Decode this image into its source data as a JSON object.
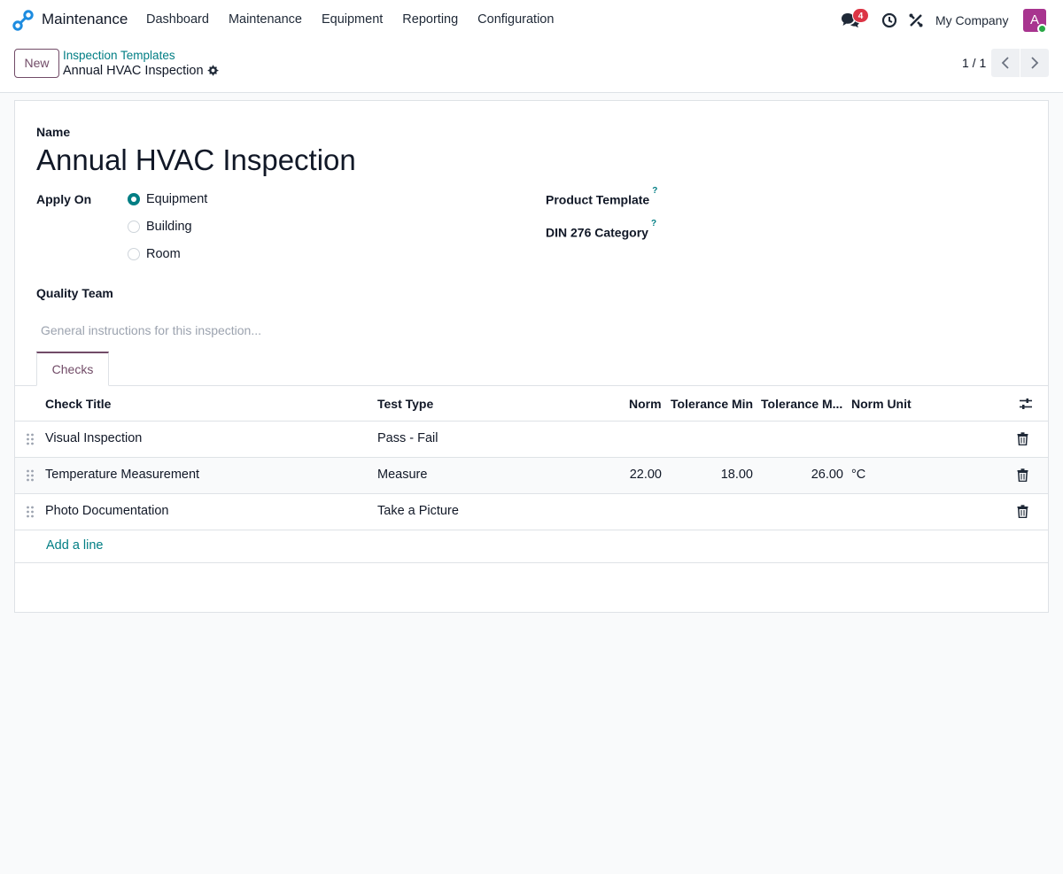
{
  "navbar": {
    "app_name": "Maintenance",
    "menu": [
      "Dashboard",
      "Maintenance",
      "Equipment",
      "Reporting",
      "Configuration"
    ],
    "chat_badge": "4",
    "company": "My Company",
    "avatar_letter": "A",
    "icons": [
      "app-logo-icon",
      "chat-icon",
      "clock-icon",
      "tools-icon"
    ]
  },
  "control_panel": {
    "new_label": "New",
    "breadcrumb_parent": "Inspection Templates",
    "breadcrumb_current": "Annual HVAC Inspection",
    "pager": "1 / 1"
  },
  "form": {
    "name_label": "Name",
    "name_value": "Annual HVAC Inspection",
    "apply_on_label": "Apply On",
    "apply_on_options": [
      {
        "label": "Equipment",
        "checked": true
      },
      {
        "label": "Building",
        "checked": false
      },
      {
        "label": "Room",
        "checked": false
      }
    ],
    "product_template_label": "Product Template",
    "din_category_label": "DIN 276 Category",
    "help_mark": "?",
    "quality_team_label": "Quality Team",
    "notes_placeholder": "General instructions for this inspection..."
  },
  "tabs": [
    "Checks"
  ],
  "checks_table": {
    "columns": [
      "Check Title",
      "Test Type",
      "Norm",
      "Tolerance Min",
      "Tolerance M...",
      "Norm Unit"
    ],
    "rows": [
      {
        "title": "Visual Inspection",
        "test_type": "Pass - Fail",
        "norm": "",
        "tol_min": "",
        "tol_max": "",
        "unit": ""
      },
      {
        "title": "Temperature Measurement",
        "test_type": "Measure",
        "norm": "22.00",
        "tol_min": "18.00",
        "tol_max": "26.00",
        "unit": "°C"
      },
      {
        "title": "Photo Documentation",
        "test_type": "Take a Picture",
        "norm": "",
        "tol_min": "",
        "tol_max": "",
        "unit": ""
      }
    ],
    "add_line_label": "Add a line"
  },
  "colors": {
    "brand_purple": "#714b67",
    "accent_teal": "#017e84",
    "badge_red": "#dc3545",
    "avatar_magenta": "#a8348f",
    "online_green": "#28a745"
  }
}
